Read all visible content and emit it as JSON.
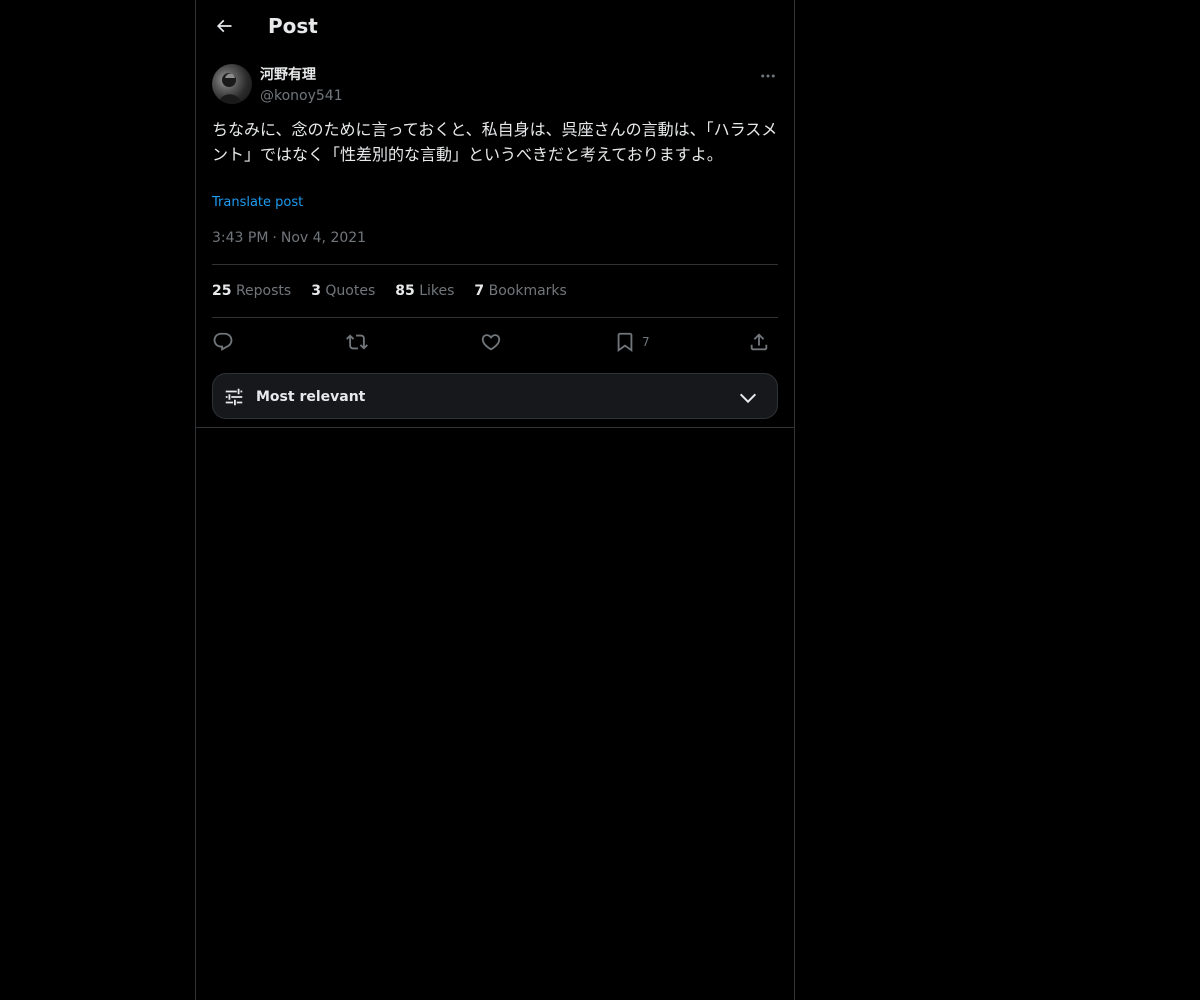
{
  "header": {
    "title": "Post",
    "back_icon": "arrow-left-icon"
  },
  "post": {
    "author": {
      "display_name": "河野有理",
      "handle": "@konoy541"
    },
    "text": "ちなみに、念のために言っておくと、私自身は、呉座さんの言動は、「ハラスメント」ではなく「性差別的な言動」というべきだと考えておりますよ。",
    "translate_label": "Translate post",
    "time": "3:43 PM",
    "separator": "·",
    "date": "Nov 4, 2021"
  },
  "stats": {
    "reposts_count": "25",
    "reposts_label": "Reposts",
    "quotes_count": "3",
    "quotes_label": "Quotes",
    "likes_count": "85",
    "likes_label": "Likes",
    "bookmarks_count": "7",
    "bookmarks_label": "Bookmarks"
  },
  "actions": {
    "reply_icon": "reply-icon",
    "repost_icon": "repost-icon",
    "like_icon": "heart-icon",
    "bookmark_icon": "bookmark-icon",
    "bookmark_count": "7",
    "share_icon": "share-icon"
  },
  "sort": {
    "label": "Most relevant"
  },
  "colors": {
    "background": "#000000",
    "text": "#e7e9ea",
    "muted": "#71767b",
    "link": "#1d9bf0",
    "border": "#2f3336"
  }
}
